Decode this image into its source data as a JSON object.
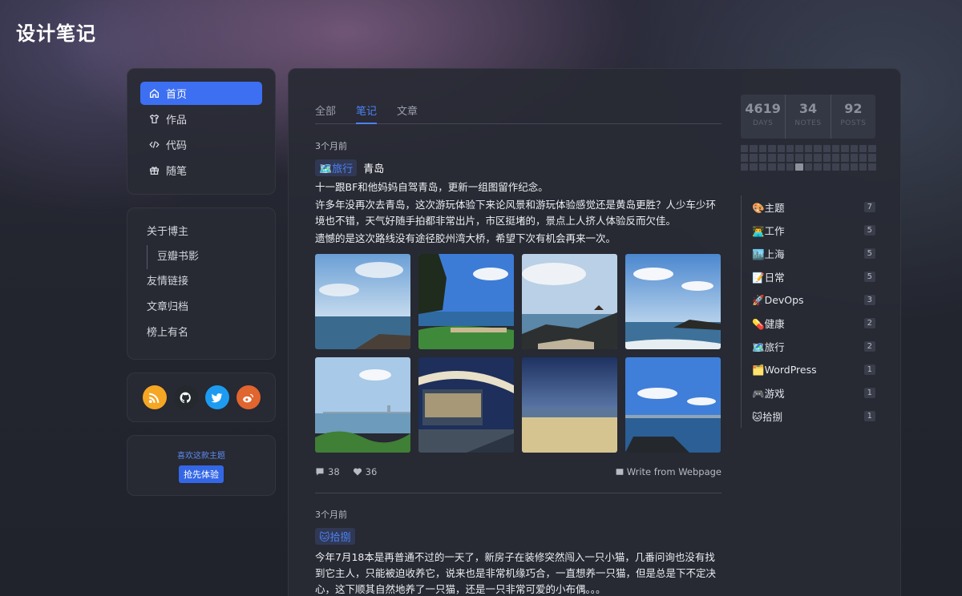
{
  "site": {
    "title": "设计笔记"
  },
  "nav": {
    "items": [
      {
        "label": "首页",
        "icon": "home-icon",
        "active": true
      },
      {
        "label": "作品",
        "icon": "shirt-icon"
      },
      {
        "label": "代码",
        "icon": "code-icon"
      },
      {
        "label": "随笔",
        "icon": "gift-icon"
      }
    ]
  },
  "links": {
    "about": "关于博主",
    "douban": "豆瓣书影",
    "friends": "友情链接",
    "archive": "文章归档",
    "ranking": "榜上有名"
  },
  "social": [
    {
      "name": "rss-icon",
      "color": "#f5a623"
    },
    {
      "name": "github-icon",
      "color": "#24292e"
    },
    {
      "name": "twitter-icon",
      "color": "#1d9bf0"
    },
    {
      "name": "weibo-icon",
      "color": "#e0652e"
    }
  ],
  "promo": {
    "text": "喜欢这款主题",
    "button": "抢先体验"
  },
  "tabs": [
    "全部",
    "笔记",
    "文章"
  ],
  "posts": [
    {
      "time": "3个月前",
      "tag": "🗺️旅行",
      "title": "青岛",
      "paragraphs": [
        "十一跟BF和他妈妈自驾青岛，更新一组图留作纪念。",
        "许多年没再次去青岛，这次游玩体验下来论风景和游玩体验感觉还是黄岛更胜？人少车少环境也不错，天气好随手拍都非常出片，市区挺堵的，景点上人挤人体验反而欠佳。",
        "遗憾的是这次路线没有途径胶州湾大桥，希望下次有机会再来一次。"
      ],
      "comments": "38",
      "likes": "36",
      "source": "Write from Webpage"
    },
    {
      "time": "3个月前",
      "tag": "🐱拾捌",
      "paragraphs": [
        "今年7月18本是再普通不过的一天了，新房子在装修突然闯入一只小猫，几番问询也没有找到它主人，只能被迫收养它，说来也是非常机缘巧合，一直想养一只猫，但是总是下不定决心，这下顺其自然地养了一只猫，还是一只非常可爱的小布偶。。。"
      ]
    }
  ],
  "stats": [
    {
      "value": "4619",
      "label": "DAYS"
    },
    {
      "value": "34",
      "label": "NOTES"
    },
    {
      "value": "92",
      "label": "POSTS"
    }
  ],
  "topics": [
    {
      "label": "🎨主题",
      "count": "7"
    },
    {
      "label": "👨‍💻工作",
      "count": "5"
    },
    {
      "label": "🏙️上海",
      "count": "5"
    },
    {
      "label": "📝日常",
      "count": "5"
    },
    {
      "label": "🚀DevOps",
      "count": "3"
    },
    {
      "label": "💊健康",
      "count": "2"
    },
    {
      "label": "🗺️旅行",
      "count": "2"
    },
    {
      "label": "🗂️WordPress",
      "count": "1"
    },
    {
      "label": "🎮游戏",
      "count": "1"
    },
    {
      "label": "🐱拾捌",
      "count": "1"
    }
  ],
  "colors": {
    "accent": "#3d6ff2",
    "link": "#4d82f5"
  }
}
